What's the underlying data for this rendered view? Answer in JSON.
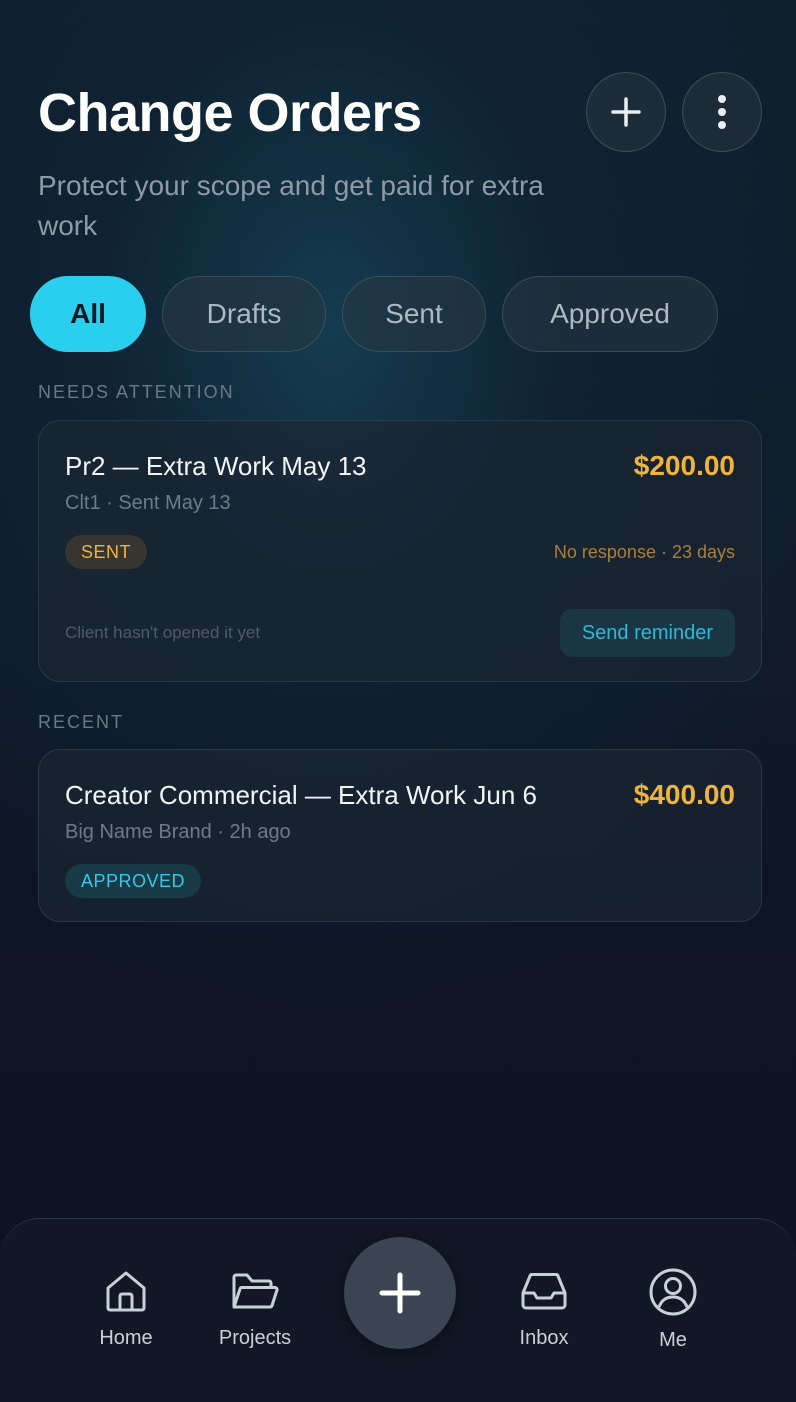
{
  "header": {
    "title": "Change Orders",
    "subtitle": "Protect your scope and get paid for extra work",
    "add_icon": "plus-icon",
    "more_icon": "vertical-dots-icon"
  },
  "filters": {
    "tabs": [
      {
        "label": "All",
        "active": true
      },
      {
        "label": "Drafts",
        "active": false
      },
      {
        "label": "Sent",
        "active": false
      },
      {
        "label": "Approved",
        "active": false
      }
    ]
  },
  "sections": {
    "needs_attention": {
      "label": "NEEDS ATTENTION",
      "card": {
        "title": "Pr2 — Extra Work May 13",
        "amount": "$200.00",
        "meta": "Clt1 · Sent May 13",
        "badge": "SENT",
        "status_note": "No response · 23 days",
        "hint": "Client hasn't opened it yet",
        "action_label": "Send reminder"
      }
    },
    "recent": {
      "label": "RECENT",
      "card": {
        "title": "Creator Commercial — Extra Work Jun 6",
        "amount": "$400.00",
        "meta": "Big Name Brand · 2h ago",
        "badge": "APPROVED"
      }
    }
  },
  "bottom_nav": {
    "items": [
      {
        "label": "Home",
        "icon": "home-icon"
      },
      {
        "label": "Projects",
        "icon": "folder-icon"
      },
      {
        "label": "Inbox",
        "icon": "inbox-icon"
      },
      {
        "label": "Me",
        "icon": "user-icon"
      }
    ],
    "fab_icon": "plus-icon"
  },
  "colors": {
    "accent": "#2bcfee",
    "amount": "#f0b43c",
    "background": "#0e1220"
  }
}
